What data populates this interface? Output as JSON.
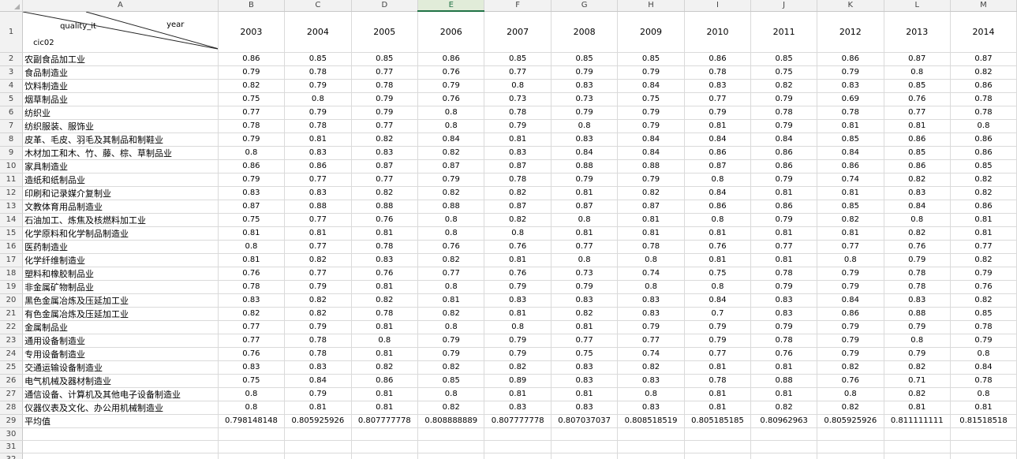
{
  "columns": [
    "A",
    "B",
    "C",
    "D",
    "E",
    "F",
    "G",
    "H",
    "I",
    "J",
    "K",
    "L",
    "M"
  ],
  "selected_column": "E",
  "header": {
    "quality_label": "quality_it",
    "year_label": "year",
    "cic_label": "cic02",
    "years": [
      "2003",
      "2004",
      "2005",
      "2006",
      "2007",
      "2008",
      "2009",
      "2010",
      "2011",
      "2012",
      "2013",
      "2014"
    ]
  },
  "rows": [
    {
      "num": "2",
      "label": "农副食品加工业",
      "values": [
        "0.86",
        "0.85",
        "0.85",
        "0.86",
        "0.85",
        "0.85",
        "0.85",
        "0.86",
        "0.85",
        "0.86",
        "0.87",
        "0.87"
      ]
    },
    {
      "num": "3",
      "label": "食品制造业",
      "values": [
        "0.79",
        "0.78",
        "0.77",
        "0.76",
        "0.77",
        "0.79",
        "0.79",
        "0.78",
        "0.75",
        "0.79",
        "0.8",
        "0.82"
      ]
    },
    {
      "num": "4",
      "label": "饮料制造业",
      "values": [
        "0.82",
        "0.79",
        "0.78",
        "0.79",
        "0.8",
        "0.83",
        "0.84",
        "0.83",
        "0.82",
        "0.83",
        "0.85",
        "0.86"
      ]
    },
    {
      "num": "5",
      "label": "烟草制品业",
      "values": [
        "0.75",
        "0.8",
        "0.79",
        "0.76",
        "0.73",
        "0.73",
        "0.75",
        "0.77",
        "0.79",
        "0.69",
        "0.76",
        "0.78"
      ]
    },
    {
      "num": "6",
      "label": "纺织业",
      "values": [
        "0.77",
        "0.79",
        "0.79",
        "0.8",
        "0.78",
        "0.79",
        "0.79",
        "0.79",
        "0.78",
        "0.78",
        "0.77",
        "0.78"
      ]
    },
    {
      "num": "7",
      "label": "纺织服装、服饰业",
      "values": [
        "0.78",
        "0.78",
        "0.77",
        "0.8",
        "0.79",
        "0.8",
        "0.79",
        "0.81",
        "0.79",
        "0.81",
        "0.81",
        "0.8"
      ]
    },
    {
      "num": "8",
      "label": "皮革、毛皮、羽毛及其制品和制鞋业",
      "values": [
        "0.79",
        "0.81",
        "0.82",
        "0.84",
        "0.81",
        "0.83",
        "0.84",
        "0.84",
        "0.84",
        "0.85",
        "0.86",
        "0.86"
      ]
    },
    {
      "num": "9",
      "label": "木材加工和木、竹、藤、棕、草制品业",
      "values": [
        "0.8",
        "0.83",
        "0.83",
        "0.82",
        "0.83",
        "0.84",
        "0.84",
        "0.86",
        "0.86",
        "0.84",
        "0.85",
        "0.86"
      ]
    },
    {
      "num": "10",
      "label": "家具制造业",
      "values": [
        "0.86",
        "0.86",
        "0.87",
        "0.87",
        "0.87",
        "0.88",
        "0.88",
        "0.87",
        "0.86",
        "0.86",
        "0.86",
        "0.85"
      ]
    },
    {
      "num": "11",
      "label": "造纸和纸制品业",
      "values": [
        "0.79",
        "0.77",
        "0.77",
        "0.79",
        "0.78",
        "0.79",
        "0.79",
        "0.8",
        "0.79",
        "0.74",
        "0.82",
        "0.82"
      ]
    },
    {
      "num": "12",
      "label": "印刷和记录媒介复制业",
      "values": [
        "0.83",
        "0.83",
        "0.82",
        "0.82",
        "0.82",
        "0.81",
        "0.82",
        "0.84",
        "0.81",
        "0.81",
        "0.83",
        "0.82"
      ]
    },
    {
      "num": "13",
      "label": "文教体育用品制造业",
      "values": [
        "0.87",
        "0.88",
        "0.88",
        "0.88",
        "0.87",
        "0.87",
        "0.87",
        "0.86",
        "0.86",
        "0.85",
        "0.84",
        "0.86"
      ]
    },
    {
      "num": "14",
      "label": "石油加工、炼焦及核燃料加工业",
      "values": [
        "0.75",
        "0.77",
        "0.76",
        "0.8",
        "0.82",
        "0.8",
        "0.81",
        "0.8",
        "0.79",
        "0.82",
        "0.8",
        "0.81"
      ]
    },
    {
      "num": "15",
      "label": "化学原料和化学制品制造业",
      "values": [
        "0.81",
        "0.81",
        "0.81",
        "0.8",
        "0.8",
        "0.81",
        "0.81",
        "0.81",
        "0.81",
        "0.81",
        "0.82",
        "0.81"
      ]
    },
    {
      "num": "16",
      "label": "医药制造业",
      "values": [
        "0.8",
        "0.77",
        "0.78",
        "0.76",
        "0.76",
        "0.77",
        "0.78",
        "0.76",
        "0.77",
        "0.77",
        "0.76",
        "0.77"
      ]
    },
    {
      "num": "17",
      "label": "化学纤维制造业",
      "values": [
        "0.81",
        "0.82",
        "0.83",
        "0.82",
        "0.81",
        "0.8",
        "0.8",
        "0.81",
        "0.81",
        "0.8",
        "0.79",
        "0.82"
      ]
    },
    {
      "num": "18",
      "label": "塑料和橡胶制品业",
      "values": [
        "0.76",
        "0.77",
        "0.76",
        "0.77",
        "0.76",
        "0.73",
        "0.74",
        "0.75",
        "0.78",
        "0.79",
        "0.78",
        "0.79"
      ]
    },
    {
      "num": "19",
      "label": "非金属矿物制品业",
      "values": [
        "0.78",
        "0.79",
        "0.81",
        "0.8",
        "0.79",
        "0.79",
        "0.8",
        "0.8",
        "0.79",
        "0.79",
        "0.78",
        "0.76"
      ]
    },
    {
      "num": "20",
      "label": "黑色金属冶炼及压延加工业",
      "values": [
        "0.83",
        "0.82",
        "0.82",
        "0.81",
        "0.83",
        "0.83",
        "0.83",
        "0.84",
        "0.83",
        "0.84",
        "0.83",
        "0.82"
      ]
    },
    {
      "num": "21",
      "label": "有色金属冶炼及压延加工业",
      "values": [
        "0.82",
        "0.82",
        "0.78",
        "0.82",
        "0.81",
        "0.82",
        "0.83",
        "0.7",
        "0.83",
        "0.86",
        "0.88",
        "0.85"
      ]
    },
    {
      "num": "22",
      "label": "金属制品业",
      "values": [
        "0.77",
        "0.79",
        "0.81",
        "0.8",
        "0.8",
        "0.81",
        "0.79",
        "0.79",
        "0.79",
        "0.79",
        "0.79",
        "0.78"
      ]
    },
    {
      "num": "23",
      "label": "通用设备制造业",
      "values": [
        "0.77",
        "0.78",
        "0.8",
        "0.79",
        "0.79",
        "0.77",
        "0.77",
        "0.79",
        "0.78",
        "0.79",
        "0.8",
        "0.79"
      ]
    },
    {
      "num": "24",
      "label": "专用设备制造业",
      "values": [
        "0.76",
        "0.78",
        "0.81",
        "0.79",
        "0.79",
        "0.75",
        "0.74",
        "0.77",
        "0.76",
        "0.79",
        "0.79",
        "0.8"
      ]
    },
    {
      "num": "25",
      "label": "交通运输设备制造业",
      "values": [
        "0.83",
        "0.83",
        "0.82",
        "0.82",
        "0.82",
        "0.83",
        "0.82",
        "0.81",
        "0.81",
        "0.82",
        "0.82",
        "0.84"
      ]
    },
    {
      "num": "26",
      "label": "电气机械及器材制造业",
      "values": [
        "0.75",
        "0.84",
        "0.86",
        "0.85",
        "0.89",
        "0.83",
        "0.83",
        "0.78",
        "0.88",
        "0.76",
        "0.71",
        "0.78"
      ]
    },
    {
      "num": "27",
      "label": "通信设备、计算机及其他电子设备制造业",
      "values": [
        "0.8",
        "0.79",
        "0.81",
        "0.8",
        "0.81",
        "0.81",
        "0.8",
        "0.81",
        "0.81",
        "0.8",
        "0.82",
        "0.8"
      ]
    },
    {
      "num": "28",
      "label": "仪器仪表及文化、办公用机械制造业",
      "values": [
        "0.8",
        "0.81",
        "0.81",
        "0.82",
        "0.83",
        "0.83",
        "0.83",
        "0.81",
        "0.82",
        "0.82",
        "0.81",
        "0.81"
      ]
    },
    {
      "num": "29",
      "label": "平均值",
      "values": [
        "0.798148148",
        "0.805925926",
        "0.807777778",
        "0.808888889",
        "0.807777778",
        "0.807037037",
        "0.808518519",
        "0.805185185",
        "0.80962963",
        "0.805925926",
        "0.811111111",
        "0.81518518"
      ]
    }
  ],
  "empty_rows": [
    "30",
    "31",
    "32"
  ],
  "row1_num": "1"
}
